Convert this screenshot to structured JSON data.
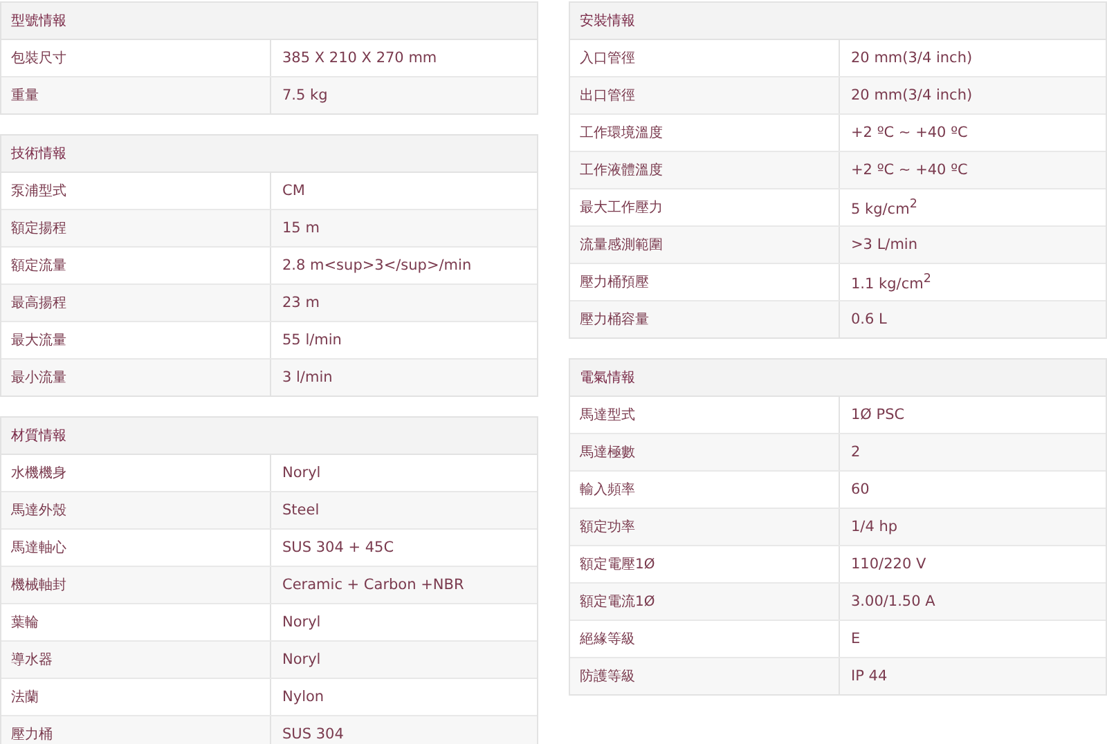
{
  "columns": [
    {
      "tables": [
        {
          "title": "型號情報",
          "rows": [
            {
              "label": "包裝尺寸",
              "value": "385 X 210 X 270 mm"
            },
            {
              "label": "重量",
              "value": "7.5 kg"
            }
          ]
        },
        {
          "title": "技術情報",
          "rows": [
            {
              "label": "泵浦型式",
              "value": "CM"
            },
            {
              "label": "額定揚程",
              "value": "15 m"
            },
            {
              "label": "額定流量",
              "value": "2.8 m<sup>3</sup>/min"
            },
            {
              "label": "最高揚程",
              "value": "23 m"
            },
            {
              "label": "最大流量",
              "value": "55 l/min"
            },
            {
              "label": "最小流量",
              "value": "3 l/min"
            }
          ]
        },
        {
          "title": "材質情報",
          "rows": [
            {
              "label": "水機機身",
              "value": "Noryl"
            },
            {
              "label": "馬達外殼",
              "value": "Steel"
            },
            {
              "label": "馬達軸心",
              "value": "SUS 304 + 45C"
            },
            {
              "label": "機械軸封",
              "value": "Ceramic + Carbon +NBR"
            },
            {
              "label": "葉輪",
              "value": "Noryl"
            },
            {
              "label": "導水器",
              "value": "Noryl"
            },
            {
              "label": "法蘭",
              "value": "Nylon"
            },
            {
              "label": "壓力桶",
              "value": "SUS 304"
            }
          ]
        }
      ]
    },
    {
      "tables": [
        {
          "title": "安裝情報",
          "rows": [
            {
              "label": "入口管徑",
              "value": "20 mm(3/4 inch)"
            },
            {
              "label": "出口管徑",
              "value": "20 mm(3/4 inch)"
            },
            {
              "label": "工作環境溫度",
              "value": "+2 ºC ~ +40 ºC"
            },
            {
              "label": "工作液體溫度",
              "value": "+2 ºC ~ +40 ºC"
            },
            {
              "label": "最大工作壓力",
              "value": "5 kg/cm$^{2}$"
            },
            {
              "label": "流量感測範圍",
              "value": ">3 L/min"
            },
            {
              "label": "壓力桶預壓",
              "value": "1.1 kg/cm$^{2}$"
            },
            {
              "label": "壓力桶容量",
              "value": "0.6 L"
            }
          ]
        },
        {
          "title": "電氣情報",
          "rows": [
            {
              "label": "馬達型式",
              "value": "1Ø PSC"
            },
            {
              "label": "馬達極數",
              "value": "2"
            },
            {
              "label": "輸入頻率",
              "value": "60"
            },
            {
              "label": "額定功率",
              "value": "1/4 hp"
            },
            {
              "label": "額定電壓1Ø",
              "value": "110/220 V"
            },
            {
              "label": "額定電流1Ø",
              "value": "3.00/1.50 A"
            },
            {
              "label": "絕緣等級",
              "value": "E"
            },
            {
              "label": "防護等級",
              "value": "IP 44"
            }
          ]
        }
      ]
    }
  ]
}
